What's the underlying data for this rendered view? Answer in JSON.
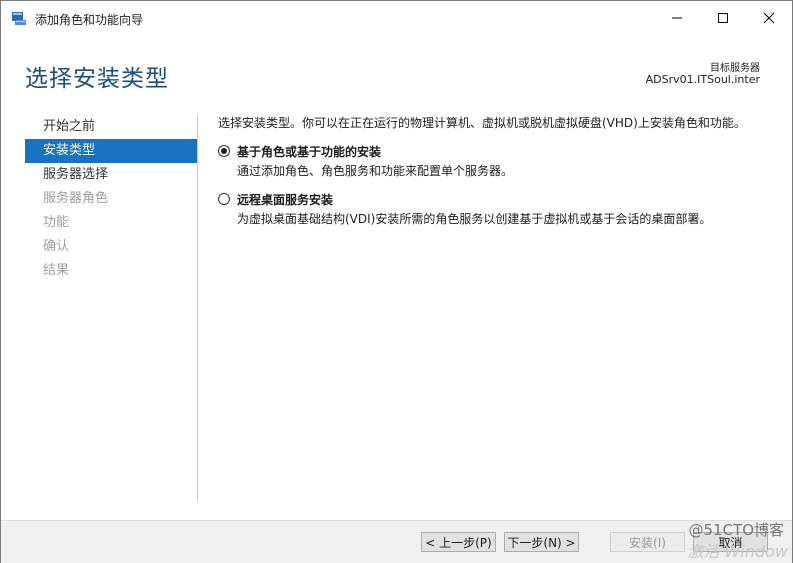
{
  "window": {
    "title": "添加角色和功能向导"
  },
  "header": {
    "page_title": "选择安装类型",
    "server_label": "目标服务器",
    "server_name": "ADSrv01.ITSoul.inter"
  },
  "nav": {
    "items": [
      {
        "label": "开始之前",
        "state": "normal"
      },
      {
        "label": "安装类型",
        "state": "active"
      },
      {
        "label": "服务器选择",
        "state": "normal"
      },
      {
        "label": "服务器角色",
        "state": "disabled"
      },
      {
        "label": "功能",
        "state": "disabled"
      },
      {
        "label": "确认",
        "state": "disabled"
      },
      {
        "label": "结果",
        "state": "disabled"
      }
    ]
  },
  "main": {
    "description": "选择安装类型。你可以在正在运行的物理计算机、虚拟机或脱机虚拟硬盘(VHD)上安装角色和功能。",
    "options": [
      {
        "label": "基于角色或基于功能的安装",
        "desc": "通过添加角色、角色服务和功能来配置单个服务器。",
        "checked": true
      },
      {
        "label": "远程桌面服务安装",
        "desc": "为虚拟桌面基础结构(VDI)安装所需的角色服务以创建基于虚拟机或基于会话的桌面部署。",
        "checked": false
      }
    ]
  },
  "footer": {
    "prev": "< 上一步(P)",
    "next": "下一步(N) >",
    "install": "安装(I)",
    "cancel": "取消"
  },
  "watermark": {
    "text": "@51CTO博客",
    "overlay": "激活 Window"
  },
  "colors": {
    "accent": "#1a73c1",
    "title": "#1f4e79"
  }
}
